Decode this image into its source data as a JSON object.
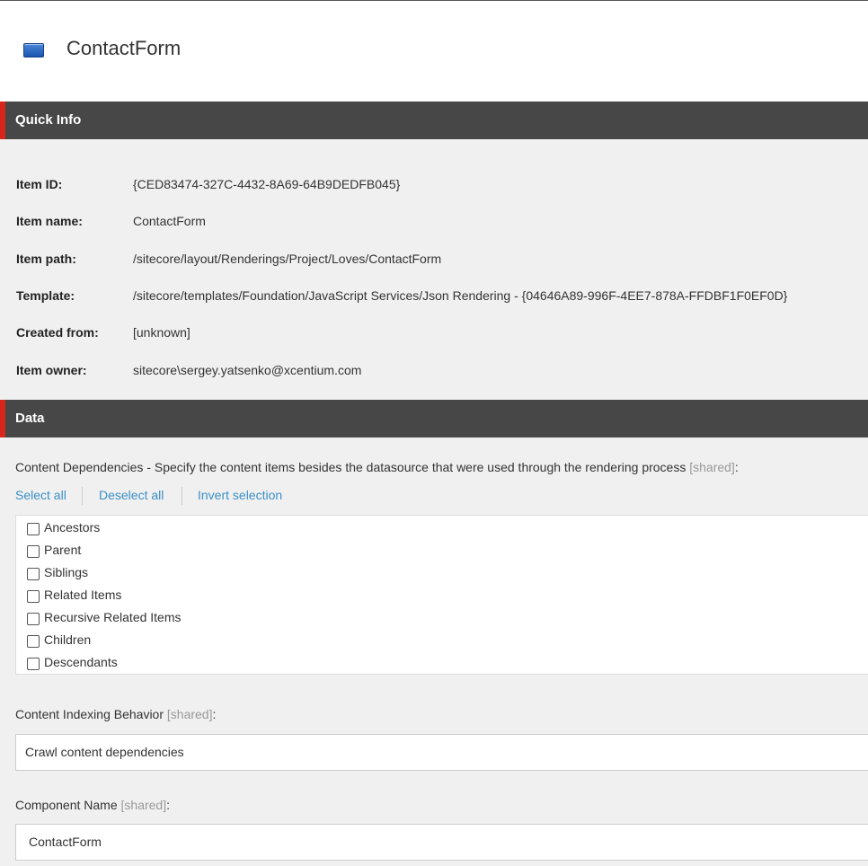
{
  "header": {
    "title": "ContactForm",
    "icon": "rendering-icon"
  },
  "quick_info": {
    "section_title": "Quick Info",
    "rows": [
      {
        "label": "Item ID:",
        "value": "{CED83474-327C-4432-8A69-64B9DEDFB045}"
      },
      {
        "label": "Item name:",
        "value": "ContactForm"
      },
      {
        "label": "Item path:",
        "value": "/sitecore/layout/Renderings/Project/Loves/ContactForm"
      },
      {
        "label": "Template:",
        "value": "/sitecore/templates/Foundation/JavaScript Services/Json Rendering - {04646A89-996F-4EE7-878A-FFDBF1F0EF0D}"
      },
      {
        "label": "Created from:",
        "value": "[unknown]"
      },
      {
        "label": "Item owner:",
        "value": "sitecore\\sergey.yatsenko@xcentium.com"
      }
    ]
  },
  "data_section": {
    "section_title": "Data",
    "content_dependencies": {
      "label": "Content Dependencies - Specify the content items besides the datasource that were used through the rendering process",
      "shared": "[shared]",
      "suffix": ":",
      "select_all": "Select all",
      "deselect_all": "Deselect all",
      "invert_selection": "Invert selection",
      "options": [
        {
          "label": "Ancestors",
          "checked": false
        },
        {
          "label": "Parent",
          "checked": false
        },
        {
          "label": "Siblings",
          "checked": false
        },
        {
          "label": "Related Items",
          "checked": false
        },
        {
          "label": "Recursive Related Items",
          "checked": false
        },
        {
          "label": "Children",
          "checked": false
        },
        {
          "label": "Descendants",
          "checked": false
        }
      ]
    },
    "content_indexing": {
      "label": "Content Indexing Behavior",
      "shared": "[shared]",
      "suffix": ":",
      "value": "Crawl content dependencies"
    },
    "component_name": {
      "label": "Component Name",
      "shared": "[shared]",
      "suffix": ":",
      "value": "ContactForm"
    }
  },
  "colors": {
    "section_bar": "#474747",
    "accent": "#d9261c",
    "link": "#3a8fc7",
    "background": "#f0f0f0"
  }
}
